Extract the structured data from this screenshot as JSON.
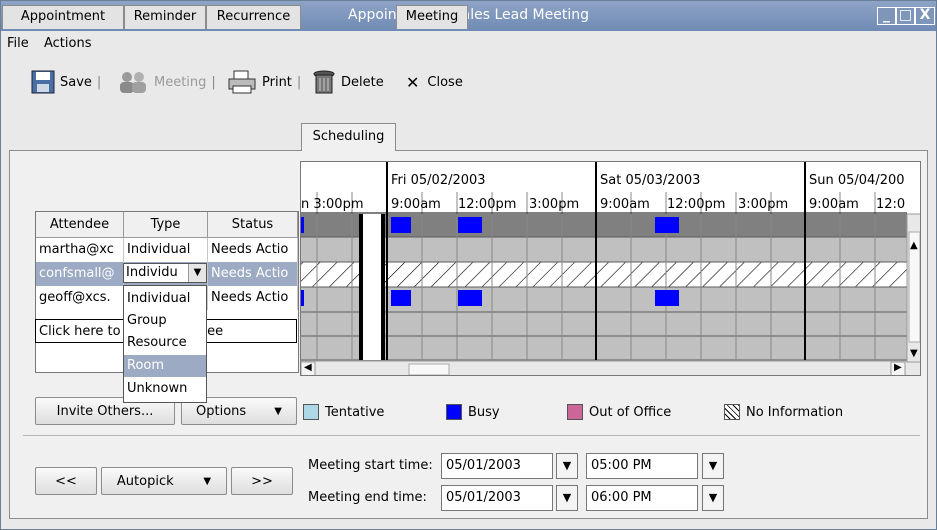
{
  "window": {
    "title": "Appointment - Sales Lead Meeting",
    "min": "_",
    "max": "□",
    "close": "X"
  },
  "menu": [
    "File",
    "Actions"
  ],
  "toolbar": {
    "save": "Save",
    "meeting": "Meeting",
    "print": "Print",
    "delete": "Delete",
    "close": "Close",
    "sep": "|"
  },
  "tabs": [
    "Appointment",
    "Reminder",
    "Recurrence",
    "Scheduling",
    "Meeting"
  ],
  "attendees": {
    "headers": [
      "Attendee",
      "Type",
      "Status"
    ],
    "rows": [
      {
        "attendee": "martha@xc",
        "type": "Individual",
        "status": "Needs Actio"
      },
      {
        "attendee": "confsmall@",
        "type": "Individu",
        "status": "Needs Actio"
      },
      {
        "attendee": "geoff@xcs.",
        "type": "",
        "status": "Needs Actio"
      }
    ],
    "add_placeholder_left": "Click here to",
    "add_placeholder_right": "ndee"
  },
  "type_options": [
    "Individual",
    "Group",
    "Resource",
    "Room",
    "Unknown"
  ],
  "schedule": {
    "days": [
      "Fri 05/02/2003",
      "Sat 05/03/2003",
      "Sun 05/04/200"
    ],
    "time_labels": [
      "n  3:00pm",
      "9:00am",
      "12:00pm",
      "3:00pm",
      "9:00am",
      "12:00pm",
      "3:00pm",
      "9:00am",
      "12:0"
    ]
  },
  "buttons": {
    "invite": "Invite Others...",
    "options": "Options",
    "prev": "<<",
    "autopick": "Autopick",
    "next": ">>"
  },
  "legend": {
    "tentative": "Tentative",
    "busy": "Busy",
    "out_of_office": "Out of Office",
    "no_info": "No Information",
    "colors": {
      "tentative": "#add8e6",
      "busy": "#0000ff",
      "out_of_office": "#cc6699"
    }
  },
  "meeting_time": {
    "start_label": "Meeting start time:",
    "start_date": "05/01/2003",
    "start_time": "05:00 PM",
    "end_label": "Meeting end time:",
    "end_date": "05/01/2003",
    "end_time": "06:00 PM"
  }
}
